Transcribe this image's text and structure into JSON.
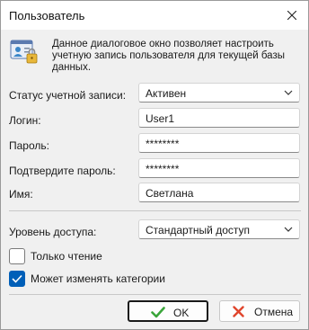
{
  "window": {
    "title": "Пользователь",
    "close_icon": "close-icon"
  },
  "info": {
    "icon": "user-lock-icon",
    "text": "Данное диалоговое окно позволяет настроить учетную запись пользователя для текущей базы данных."
  },
  "form": {
    "status": {
      "label": "Статус учетной записи:",
      "value": "Активен"
    },
    "login": {
      "label": "Логин:",
      "value": "User1"
    },
    "password": {
      "label": "Пароль:",
      "value": "********"
    },
    "confirm": {
      "label": "Подтвердите пароль:",
      "value": "********"
    },
    "name": {
      "label": "Имя:",
      "value": "Светлана"
    },
    "access": {
      "label": "Уровень доступа:",
      "value": "Стандартный доступ"
    }
  },
  "options": {
    "read_only": {
      "label": "Только чтение",
      "checked": false
    },
    "edit_categories": {
      "label": "Может изменять категории",
      "checked": true
    }
  },
  "buttons": {
    "ok": "OK",
    "cancel": "Отмена"
  },
  "colors": {
    "accent": "#005fb8",
    "ok_check": "#3aa53a",
    "cancel_x": "#e0452c"
  }
}
